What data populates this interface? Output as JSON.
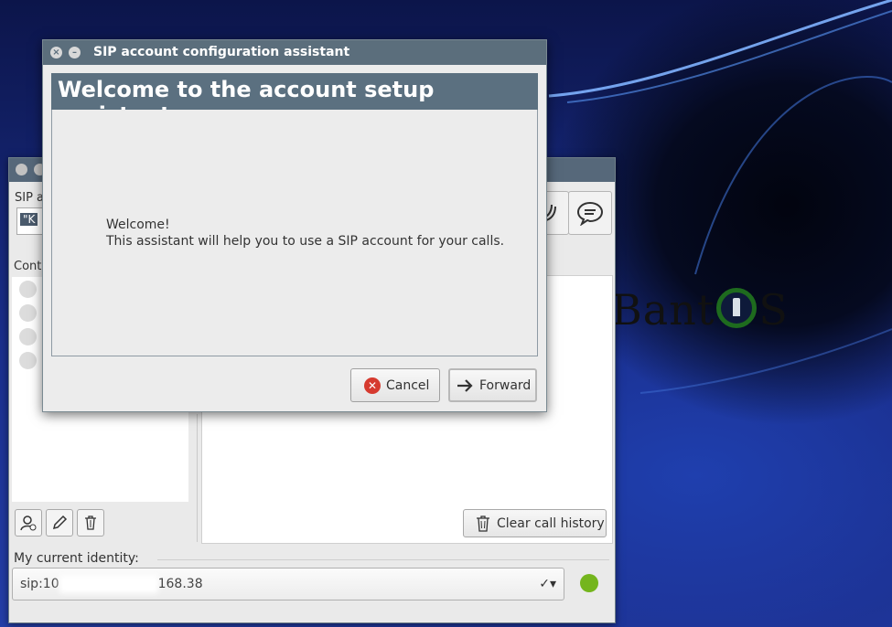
{
  "dialog": {
    "title": "SIP account configuration assistant",
    "heading": "Welcome to the account setup assistant",
    "welcome_line1": "Welcome!",
    "welcome_line2": "This assistant will help you to use a SIP account for your calls.",
    "cancel_label": "Cancel",
    "forward_label": "Forward"
  },
  "main_window": {
    "sip_label": "SIP a",
    "sip_field_value": "\"K",
    "contacts_label": "Cont",
    "clear_history_label": "Clear call history",
    "identity_label": "My current identity:",
    "identity_prefix": "sip:10",
    "identity_suffix": "168.38",
    "identity_arrow": "✓▾",
    "status_color": "#74b51d"
  },
  "desktop": {
    "logo_left": "Bant",
    "logo_right": "S"
  }
}
